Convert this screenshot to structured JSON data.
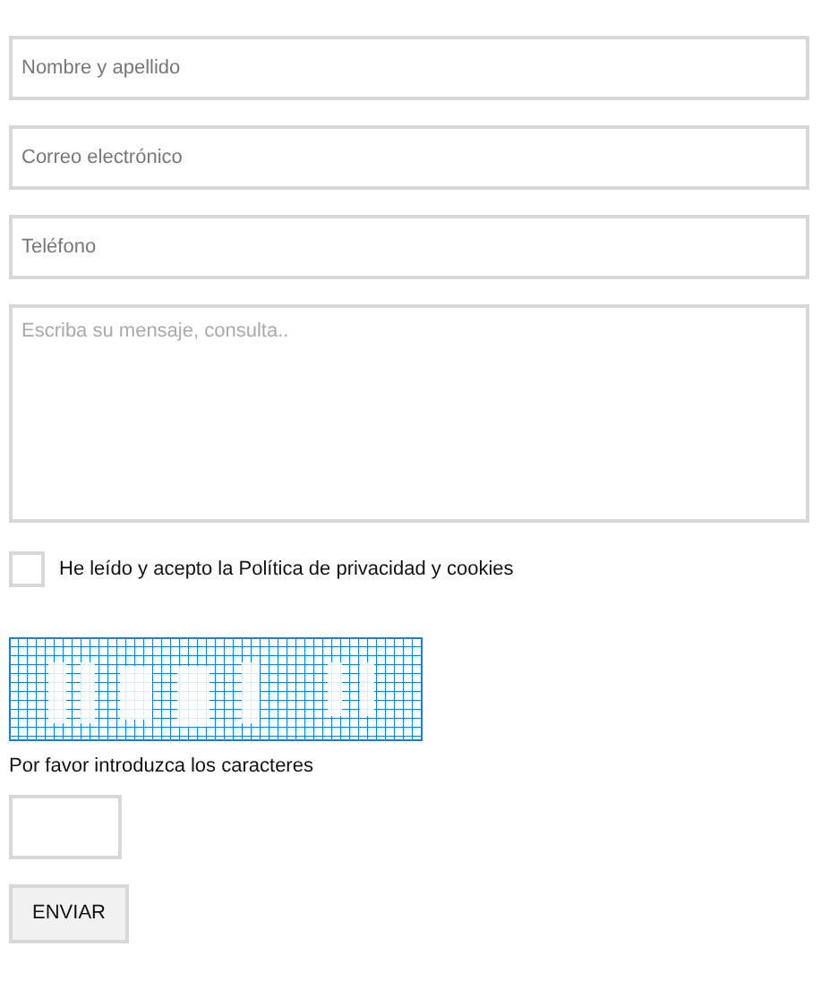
{
  "fields": [
    {
      "kind": "input",
      "placeholder": "Nombre y apellido"
    },
    {
      "kind": "input",
      "placeholder": "Correo electrónico"
    },
    {
      "kind": "input",
      "placeholder": "Teléfono"
    },
    {
      "kind": "textarea",
      "placeholder": "Escriba su mensaje, consulta.."
    }
  ],
  "consent": {
    "label": "He leído y acepto la Política de privacidad y cookies",
    "checked": false
  },
  "captcha": {
    "caption": "Por favor introduzca los caracteres"
  },
  "submit": "ENVIAR"
}
